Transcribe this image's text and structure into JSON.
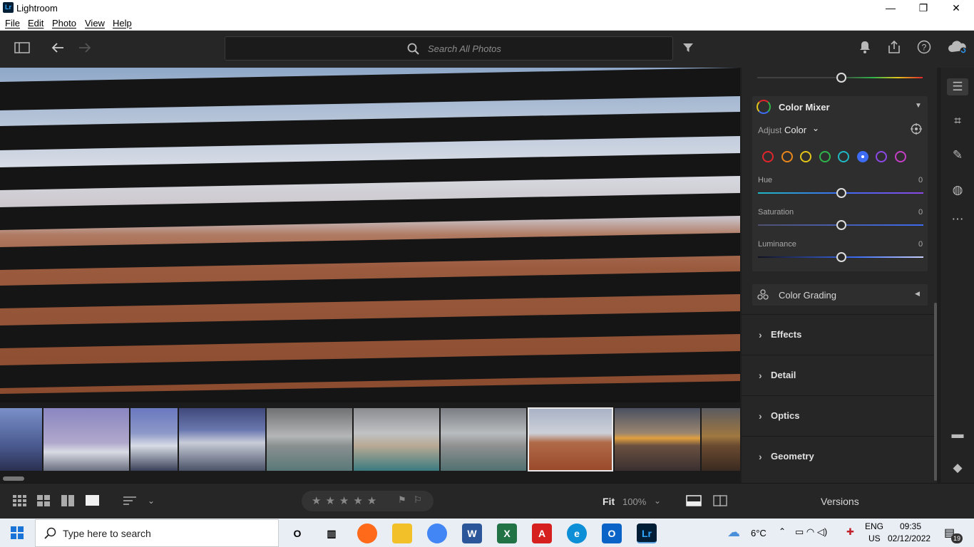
{
  "window": {
    "app_badge": "Lr",
    "title": "Lightroom",
    "minimize": "—",
    "maximize": "❐",
    "close": "✕"
  },
  "menu": [
    "File",
    "Edit",
    "Photo",
    "View",
    "Help"
  ],
  "search": {
    "placeholder": "Search All Photos"
  },
  "panel": {
    "color_mixer": {
      "title": "Color Mixer",
      "adjust_label": "Adjust",
      "adjust_value": "Color",
      "swatches": [
        "#e0262b",
        "#e8871b",
        "#e3c41b",
        "#2fb54a",
        "#1fb8c4",
        "#3d6cf2",
        "#8c48e6",
        "#c43fc6"
      ],
      "selected_swatch": 5,
      "sliders": [
        {
          "label": "Hue",
          "value": "0"
        },
        {
          "label": "Saturation",
          "value": "0"
        },
        {
          "label": "Luminance",
          "value": "0"
        }
      ]
    },
    "color_grading": "Color Grading",
    "sections": [
      "Effects",
      "Detail",
      "Optics",
      "Geometry"
    ]
  },
  "bottombar": {
    "fit": "Fit",
    "zoom": "100%",
    "versions": "Versions"
  },
  "taskbar": {
    "search_placeholder": "Type here to search",
    "weather": "6°C",
    "lang_top": "ENG",
    "lang_bottom": "US",
    "time": "09:35",
    "date": "02/12/2022",
    "notifications": "19",
    "apps": [
      {
        "name": "cortana",
        "label": "O",
        "color": "#e9eef4"
      },
      {
        "name": "task-view",
        "label": "▥",
        "color": "#e9eef4"
      },
      {
        "name": "firefox",
        "label": "",
        "color": "#ff6a1a"
      },
      {
        "name": "file-explorer",
        "label": "",
        "color": "#f2c029"
      },
      {
        "name": "chrome",
        "label": "",
        "color": "#4285f4"
      },
      {
        "name": "word",
        "label": "W",
        "color": "#2b579a"
      },
      {
        "name": "excel",
        "label": "X",
        "color": "#217346"
      },
      {
        "name": "acrobat",
        "label": "A",
        "color": "#d6201f"
      },
      {
        "name": "edge",
        "label": "e",
        "color": "#0c8fd6"
      },
      {
        "name": "outlook",
        "label": "O",
        "color": "#0a64c8"
      },
      {
        "name": "lightroom",
        "label": "Lr",
        "color": "#001e36"
      }
    ]
  }
}
